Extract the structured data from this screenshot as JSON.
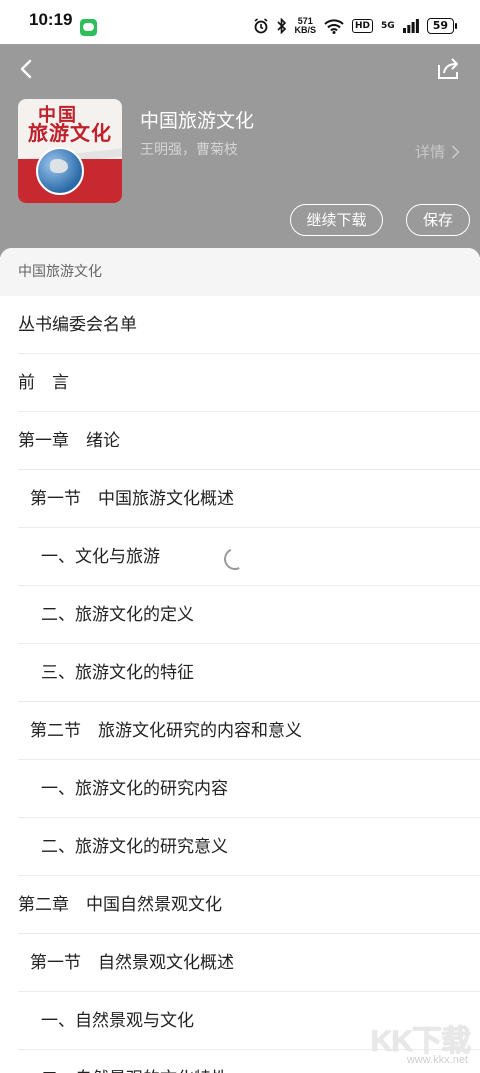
{
  "status_bar": {
    "time": "10:19",
    "net_speed_value": "571",
    "net_speed_unit": "KB/S",
    "hd": "HD",
    "signal": "5G",
    "battery": "59",
    "icons": [
      "chat-app-icon",
      "alarm-icon",
      "bluetooth-icon",
      "wifi-icon",
      "signal-icon"
    ]
  },
  "header": {
    "book_title": "中国旅游文化",
    "author": "王明强，曹菊枝",
    "detail_label": "详情",
    "continue_download_label": "继续下载",
    "save_label": "保存",
    "cover": {
      "title_line1": "中国",
      "title_line2": "旅游文化"
    },
    "background_color": "#9a9a9a"
  },
  "toc": {
    "heading": "中国旅游文化",
    "items": [
      {
        "label": "丛书编委会名单",
        "level": 0
      },
      {
        "label": "前　言",
        "level": 0
      },
      {
        "label": "第一章　绪论",
        "level": 0
      },
      {
        "label": "第一节　中国旅游文化概述",
        "level": 1
      },
      {
        "label": "一、文化与旅游",
        "level": 2
      },
      {
        "label": "二、旅游文化的定义",
        "level": 2
      },
      {
        "label": "三、旅游文化的特征",
        "level": 2
      },
      {
        "label": "第二节　旅游文化研究的内容和意义",
        "level": 1
      },
      {
        "label": "一、旅游文化的研究内容",
        "level": 2
      },
      {
        "label": "二、旅游文化的研究意义",
        "level": 2
      },
      {
        "label": "第二章　中国自然景观文化",
        "level": 0
      },
      {
        "label": "第一节　自然景观文化概述",
        "level": 1
      },
      {
        "label": "一、自然景观与文化",
        "level": 2
      },
      {
        "label": "二、自然景观的文化特性",
        "level": 2
      }
    ]
  },
  "watermark": {
    "logo": "KK下载",
    "url": "www.kkx.net"
  }
}
